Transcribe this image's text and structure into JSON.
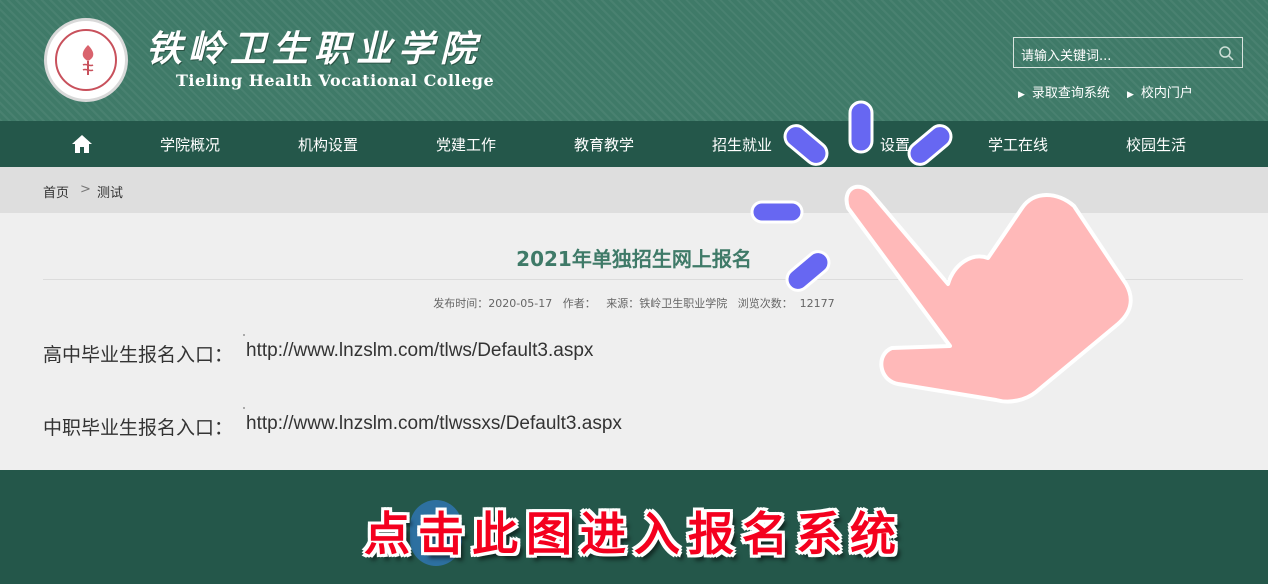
{
  "header": {
    "college_name_cn": "铁岭卫生职业学院",
    "college_name_en": "Tieling Health Vocational College",
    "logo_icon": "college-emblem",
    "search": {
      "placeholder_text": "请输入关键词...",
      "icon": "search-icon"
    },
    "quick_links": [
      "录取查询系统",
      "校内门户"
    ]
  },
  "nav": {
    "home_icon": "home-icon",
    "items": [
      "学院概况",
      "机构设置",
      "党建工作",
      "教育教学",
      "招生就业",
      "设置",
      "学工在线",
      "校园生活"
    ]
  },
  "breadcrumb": {
    "home": "首页",
    "separator": ">",
    "current": "测试"
  },
  "article": {
    "title": "2021年单独招生网上报名",
    "meta": "发布时间：2020-05-17   作者：   来源：铁岭卫生职业学院   浏览次数：  12177",
    "entries": [
      {
        "label": "高中毕业生报名入口：",
        "url": "http://www.lnzslm.com/tlws/Default3.aspx"
      },
      {
        "label": "中职毕业生报名入口：",
        "url": "http://www.lnzslm.com/tlwssxs/Default3.aspx"
      }
    ]
  },
  "overlay": {
    "banner_text": "点击此图进入报名系统",
    "hand_icon": "pointing-hand-icon",
    "colors": {
      "banner": "#f4001e",
      "hand": "#ffb9b9",
      "burst": "#6767f2"
    }
  },
  "colors": {
    "header": "#3f7a68",
    "nav": "#24574a",
    "footer": "#24574a",
    "title": "#3f7a68"
  }
}
